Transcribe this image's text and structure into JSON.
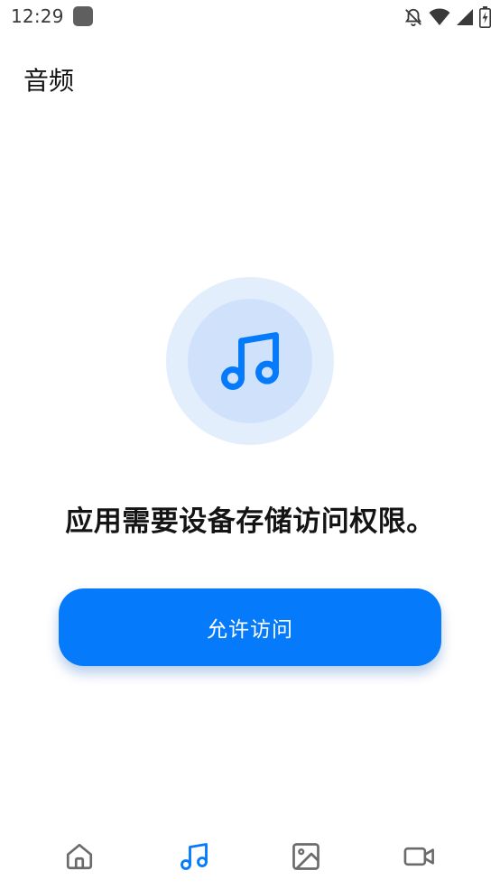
{
  "status_bar": {
    "time": "12:29",
    "icons": [
      "app-notification-icon",
      "alarm-off-icon",
      "wifi-icon",
      "cell-signal-icon",
      "battery-charging-icon"
    ]
  },
  "header": {
    "title": "音频"
  },
  "main": {
    "illustration_icon": "music-note-icon",
    "message": "应用需要设备存储访问权限。",
    "allow_button_label": "允许访问"
  },
  "bottom_nav": {
    "items": [
      {
        "icon": "home-icon",
        "active": false
      },
      {
        "icon": "music-note-icon",
        "active": true
      },
      {
        "icon": "image-icon",
        "active": false
      },
      {
        "icon": "video-camera-icon",
        "active": false
      }
    ]
  },
  "colors": {
    "accent": "#057bfc",
    "icon_inactive": "#6b6b6b",
    "circle_outer": "#e3eefd",
    "circle_inner": "#d0e2fb"
  }
}
